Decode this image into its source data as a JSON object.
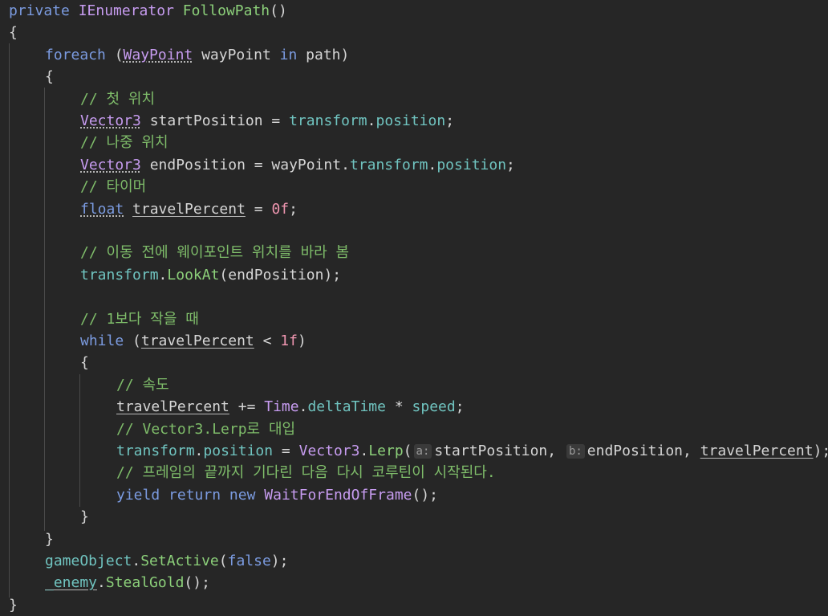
{
  "colors": {
    "background": "#262626",
    "keyword": "#7b9be0",
    "type": "#c79cf0",
    "member": "#70c4c0",
    "method": "#8cd07a",
    "comment": "#7fbd6a",
    "number": "#ef96b0",
    "text": "#d6d6d6"
  },
  "code": {
    "lines": [
      {
        "indent": 0,
        "tokens": [
          {
            "t": "private",
            "c": "kw"
          },
          {
            "t": " "
          },
          {
            "t": "IEnumerator",
            "c": "ty"
          },
          {
            "t": " "
          },
          {
            "t": "FollowPath",
            "c": "fn"
          },
          {
            "t": "()"
          }
        ]
      },
      {
        "indent": 0,
        "tokens": [
          {
            "t": "{"
          }
        ]
      },
      {
        "indent": 1,
        "tokens": [
          {
            "t": "foreach",
            "c": "kw"
          },
          {
            "t": " ("
          },
          {
            "t": "WayPoint",
            "c": "ty",
            "d": "dot"
          },
          {
            "t": " wayPoint "
          },
          {
            "t": "in",
            "c": "kw"
          },
          {
            "t": " path)"
          }
        ]
      },
      {
        "indent": 1,
        "tokens": [
          {
            "t": "{"
          }
        ]
      },
      {
        "indent": 2,
        "tokens": [
          {
            "t": "// 첫 위치",
            "c": "cm"
          }
        ]
      },
      {
        "indent": 2,
        "tokens": [
          {
            "t": "Vector3",
            "c": "ty",
            "d": "dot"
          },
          {
            "t": " startPosition = "
          },
          {
            "t": "transform",
            "c": "ci"
          },
          {
            "t": "."
          },
          {
            "t": "position",
            "c": "ci"
          },
          {
            "t": ";"
          }
        ]
      },
      {
        "indent": 2,
        "tokens": [
          {
            "t": "// 나중 위치",
            "c": "cm"
          }
        ]
      },
      {
        "indent": 2,
        "tokens": [
          {
            "t": "Vector3",
            "c": "ty",
            "d": "dot"
          },
          {
            "t": " endPosition = wayPoint."
          },
          {
            "t": "transform",
            "c": "ci"
          },
          {
            "t": "."
          },
          {
            "t": "position",
            "c": "ci"
          },
          {
            "t": ";"
          }
        ]
      },
      {
        "indent": 2,
        "tokens": [
          {
            "t": "// 타이머",
            "c": "cm"
          }
        ]
      },
      {
        "indent": 2,
        "tokens": [
          {
            "t": "float",
            "c": "kw",
            "d": "dot"
          },
          {
            "t": " "
          },
          {
            "t": "travelPercent",
            "d": "ul"
          },
          {
            "t": " = "
          },
          {
            "t": "0f",
            "c": "nm"
          },
          {
            "t": ";"
          }
        ]
      },
      {
        "indent": 2,
        "tokens": []
      },
      {
        "indent": 2,
        "tokens": [
          {
            "t": "// 이동 전에 웨이포인트 위치를 바라 봄",
            "c": "cm"
          }
        ]
      },
      {
        "indent": 2,
        "tokens": [
          {
            "t": "transform",
            "c": "ci"
          },
          {
            "t": "."
          },
          {
            "t": "LookAt",
            "c": "fn"
          },
          {
            "t": "(endPosition);"
          }
        ]
      },
      {
        "indent": 2,
        "tokens": []
      },
      {
        "indent": 2,
        "tokens": [
          {
            "t": "// 1보다 작을 때",
            "c": "cm"
          }
        ]
      },
      {
        "indent": 2,
        "tokens": [
          {
            "t": "while",
            "c": "kw"
          },
          {
            "t": " ("
          },
          {
            "t": "travelPercent",
            "d": "ul"
          },
          {
            "t": " < "
          },
          {
            "t": "1f",
            "c": "nm"
          },
          {
            "t": ")"
          }
        ]
      },
      {
        "indent": 2,
        "tokens": [
          {
            "t": "{"
          }
        ]
      },
      {
        "indent": 3,
        "tokens": [
          {
            "t": "// 속도",
            "c": "cm"
          }
        ]
      },
      {
        "indent": 3,
        "tokens": [
          {
            "t": "travelPercent",
            "d": "ul"
          },
          {
            "t": " += "
          },
          {
            "t": "Time",
            "c": "ty"
          },
          {
            "t": "."
          },
          {
            "t": "deltaTime",
            "c": "ci"
          },
          {
            "t": " * "
          },
          {
            "t": "speed",
            "c": "ci"
          },
          {
            "t": ";"
          }
        ]
      },
      {
        "indent": 3,
        "tokens": [
          {
            "t": "// Vector3.Lerp로 대입",
            "c": "cm"
          }
        ]
      },
      {
        "indent": 3,
        "tokens": [
          {
            "t": "transform",
            "c": "ci"
          },
          {
            "t": "."
          },
          {
            "t": "position",
            "c": "ci"
          },
          {
            "t": " = "
          },
          {
            "t": "Vector3",
            "c": "ty"
          },
          {
            "t": "."
          },
          {
            "t": "Lerp",
            "c": "fn"
          },
          {
            "t": "("
          },
          {
            "t": "a:",
            "h": true
          },
          {
            "t": "startPosition, "
          },
          {
            "t": "b:",
            "h": true
          },
          {
            "t": "endPosition, "
          },
          {
            "t": "travelPercent",
            "d": "ul"
          },
          {
            "t": ");"
          }
        ]
      },
      {
        "indent": 3,
        "tokens": [
          {
            "t": "// 프레임의 끝까지 기다린 다음 다시 코루틴이 시작된다.",
            "c": "cm"
          }
        ]
      },
      {
        "indent": 3,
        "tokens": [
          {
            "t": "yield",
            "c": "kw"
          },
          {
            "t": " "
          },
          {
            "t": "return",
            "c": "kw"
          },
          {
            "t": " "
          },
          {
            "t": "new",
            "c": "kw"
          },
          {
            "t": " "
          },
          {
            "t": "WaitForEndOfFrame",
            "c": "ty"
          },
          {
            "t": "();"
          }
        ]
      },
      {
        "indent": 2,
        "tokens": [
          {
            "t": "}"
          }
        ]
      },
      {
        "indent": 1,
        "tokens": [
          {
            "t": "}"
          }
        ]
      },
      {
        "indent": 1,
        "tokens": [
          {
            "t": "gameObject",
            "c": "ci"
          },
          {
            "t": "."
          },
          {
            "t": "SetActive",
            "c": "fn"
          },
          {
            "t": "("
          },
          {
            "t": "false",
            "c": "kw"
          },
          {
            "t": ");"
          }
        ]
      },
      {
        "indent": 1,
        "tokens": [
          {
            "t": "_enemy",
            "c": "ci",
            "d": "ul"
          },
          {
            "t": "."
          },
          {
            "t": "StealGold",
            "c": "fn"
          },
          {
            "t": "();"
          }
        ]
      },
      {
        "indent": 0,
        "tokens": [
          {
            "t": "}"
          }
        ]
      }
    ]
  }
}
